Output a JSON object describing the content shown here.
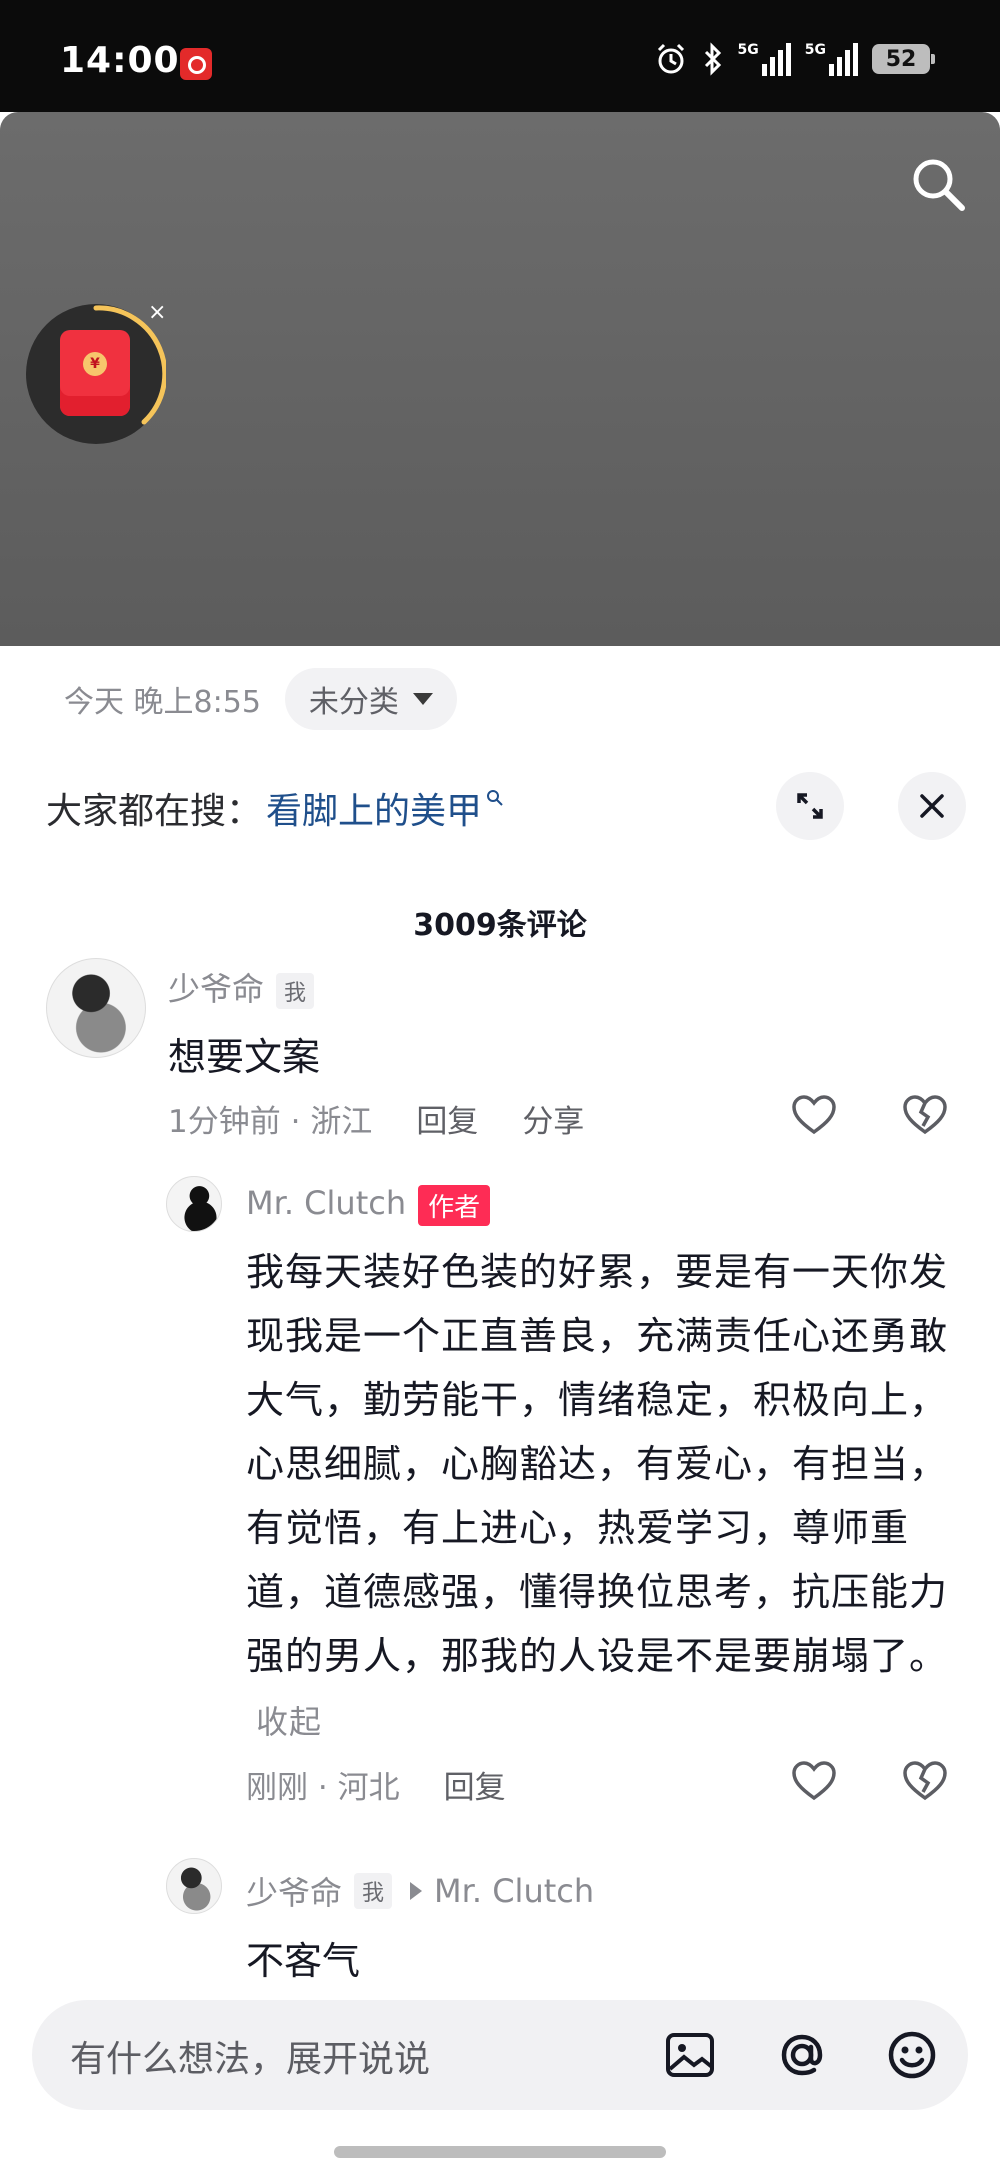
{
  "status_bar": {
    "time": "14:00",
    "network_left": "5G",
    "network_right": "5G",
    "battery": "52"
  },
  "video": {
    "search_icon": "search-icon",
    "red_packet_icon": "red-packet-icon",
    "close_glyph": "×"
  },
  "info": {
    "date": "今天 晚上8:55",
    "category": "未分类"
  },
  "hot_search": {
    "label": "大家都在搜：",
    "term": "看脚上的美甲"
  },
  "comments": {
    "count": "3009条评论",
    "items": [
      {
        "user": "少爷命",
        "tag": "我",
        "text": "想要文案",
        "time": "1分钟前",
        "location": "浙江",
        "reply": "回复",
        "share": "分享"
      }
    ],
    "replies": [
      {
        "user": "Mr. Clutch",
        "tag": "作者",
        "text": "我每天装好色装的好累，要是有一天你发现我是一个正直善良，充满责任心还勇敢大气，勤劳能干，情绪稳定，积极向上，心思细腻，心胸豁达，有爱心，有担当，有觉悟，有上进心，热爱学习，尊师重道，道德感强，懂得换位思考，抗压能力强的男人，那我的人设是不是要崩塌了。",
        "collapse": "收起",
        "time": "刚刚",
        "location": "河北",
        "reply": "回复"
      },
      {
        "user": "少爷命",
        "tag": "我",
        "reply_to": "Mr. Clutch",
        "text": "不客气"
      }
    ],
    "separator": "·"
  },
  "input": {
    "placeholder": "有什么想法，展开说说"
  },
  "colors": {
    "accent": "#fe2c55",
    "link": "#1f4f8b",
    "meta": "#8a8b91"
  }
}
